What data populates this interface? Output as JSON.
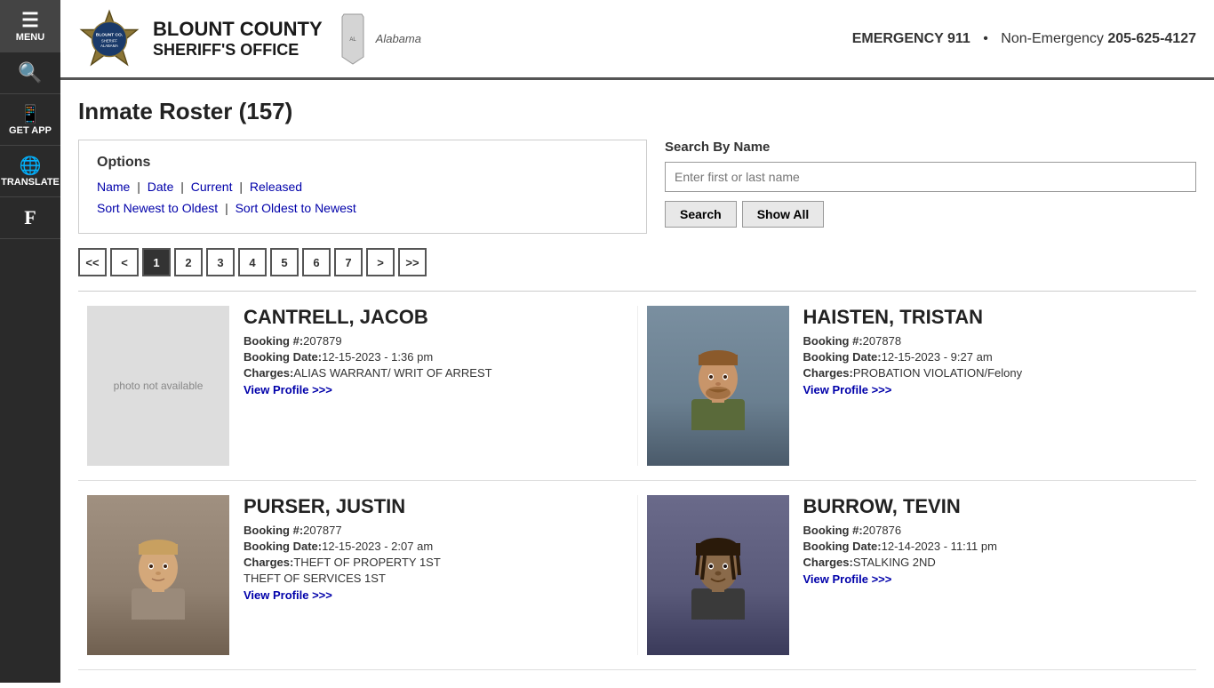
{
  "sidebar": {
    "items": [
      {
        "id": "menu",
        "label": "MENU",
        "icon": "☰"
      },
      {
        "id": "search",
        "label": "",
        "icon": "🔍"
      },
      {
        "id": "get-app",
        "label": "GET APP",
        "icon": "📱"
      },
      {
        "id": "translate",
        "label": "TRANSLATE",
        "icon": "🌐"
      },
      {
        "id": "facebook",
        "label": "",
        "icon": "f"
      }
    ]
  },
  "header": {
    "agency_line1": "BLOUNT COUNTY",
    "agency_line2": "SHERIFF'S OFFICE",
    "state": "Alabama",
    "emergency_label": "EMERGENCY 911",
    "separator": "•",
    "nonemergency_label": "Non-Emergency",
    "nonemergency_number": "205-625-4127"
  },
  "page": {
    "title": "Inmate Roster (157)"
  },
  "options": {
    "heading": "Options",
    "links": [
      {
        "id": "name",
        "label": "Name"
      },
      {
        "id": "date",
        "label": "Date"
      },
      {
        "id": "current",
        "label": "Current"
      },
      {
        "id": "released",
        "label": "Released"
      }
    ],
    "sort": [
      {
        "id": "newest",
        "label": "Sort Newest to Oldest"
      },
      {
        "id": "oldest",
        "label": "Sort Oldest to Newest"
      }
    ]
  },
  "search": {
    "heading": "Search By Name",
    "placeholder": "Enter first or last name",
    "search_btn": "Search",
    "show_all_btn": "Show All"
  },
  "pagination": {
    "buttons": [
      "<<",
      "<",
      "1",
      "2",
      "3",
      "4",
      "5",
      "6",
      "7",
      ">",
      ">>"
    ],
    "active": "1"
  },
  "inmates": [
    {
      "id": "cantrell-jacob",
      "name": "CANTRELL, JACOB",
      "booking_num": "207879",
      "booking_date": "12-15-2023 - 1:36 pm",
      "charges": "ALIAS WARRANT/ WRIT OF ARREST",
      "profile_link": "View Profile >>>",
      "has_photo": false,
      "photo_alt": "photo not available"
    },
    {
      "id": "haisten-tristan",
      "name": "HAISTEN, TRISTAN",
      "booking_num": "207878",
      "booking_date": "12-15-2023 - 9:27 am",
      "charges": "PROBATION VIOLATION/Felony",
      "profile_link": "View Profile >>>",
      "has_photo": true,
      "photo_alt": "Haisten, Tristan mugshot"
    },
    {
      "id": "purser-justin",
      "name": "PURSER, JUSTIN",
      "booking_num": "207877",
      "booking_date": "12-15-2023 - 2:07 am",
      "charges": "THEFT OF PROPERTY 1ST THEFT OF SERVICES 1ST",
      "profile_link": "View Profile >>>",
      "has_photo": true,
      "photo_alt": "Purser, Justin mugshot"
    },
    {
      "id": "burrow-tevin",
      "name": "BURROW, TEVIN",
      "booking_num": "207876",
      "booking_date": "12-14-2023 - 11:11 pm",
      "charges": "STALKING 2ND",
      "profile_link": "View Profile >>>",
      "has_photo": true,
      "photo_alt": "Burrow, Tevin mugshot"
    }
  ],
  "labels": {
    "booking_num": "Booking #:",
    "booking_date": "Booking Date:",
    "charges": "Charges:"
  }
}
